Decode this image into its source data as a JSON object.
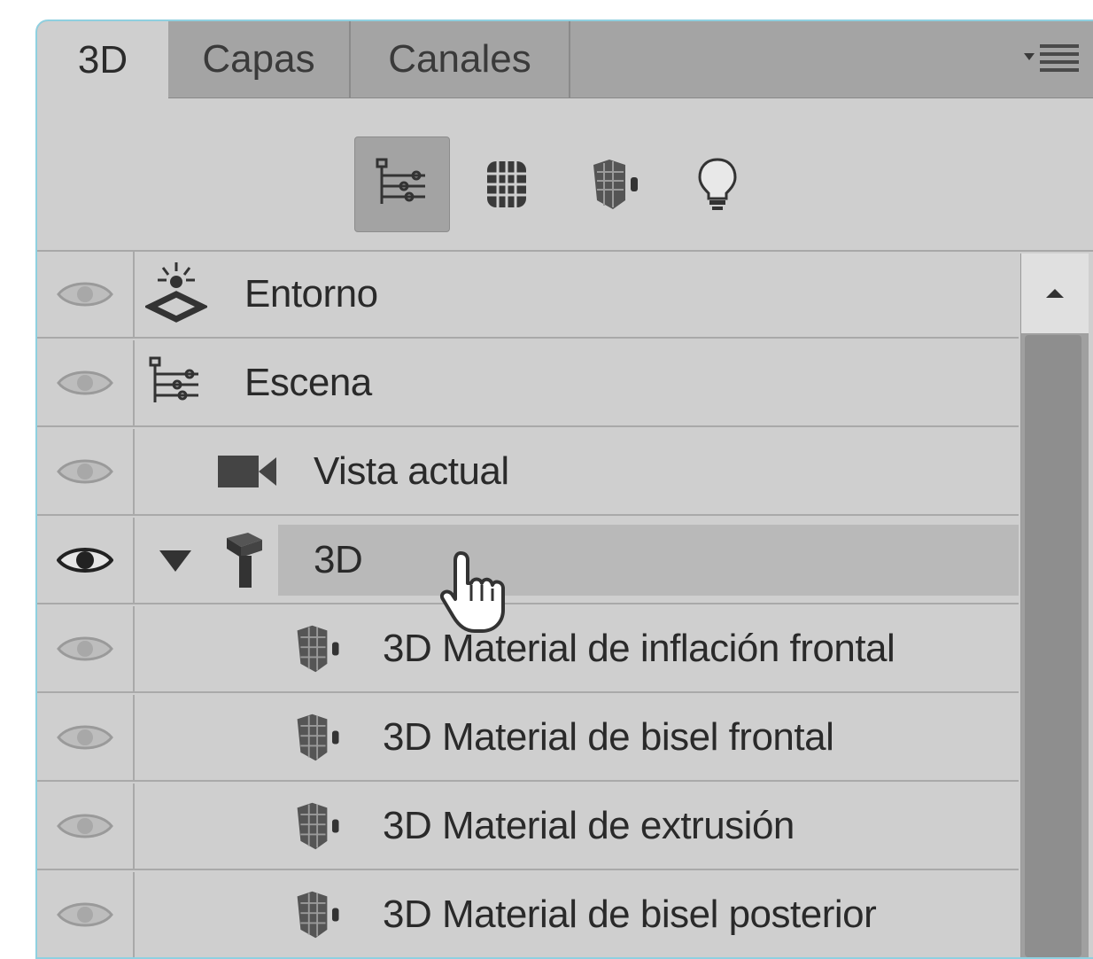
{
  "tabs": [
    {
      "label": "3D",
      "active": true
    },
    {
      "label": "Capas",
      "active": false
    },
    {
      "label": "Canales",
      "active": false
    }
  ],
  "panel_menu_icon": "panel-menu-icon",
  "toolbar": {
    "buttons": [
      {
        "name": "whole-scene",
        "icon": "scene-icon",
        "selected": true
      },
      {
        "name": "meshes",
        "icon": "mesh-icon",
        "selected": false
      },
      {
        "name": "materials",
        "icon": "material-icon",
        "selected": false
      },
      {
        "name": "lights",
        "icon": "light-icon",
        "selected": false
      }
    ]
  },
  "layers": [
    {
      "label": "Entorno",
      "icon": "environment-icon",
      "visible": true,
      "selected": false
    },
    {
      "label": "Escena",
      "icon": "scene-icon",
      "visible": true,
      "selected": false
    },
    {
      "label": "Vista actual",
      "icon": "camera-icon",
      "visible": true,
      "selected": false
    },
    {
      "label": "3D",
      "icon": "mesh-object-icon",
      "visible": true,
      "selected": true,
      "expanded": true
    },
    {
      "label": "3D Material de inflación frontal",
      "icon": "material-icon",
      "visible": true,
      "selected": false
    },
    {
      "label": "3D Material de bisel frontal",
      "icon": "material-icon",
      "visible": true,
      "selected": false
    },
    {
      "label": "3D Material de extrusión",
      "icon": "material-icon",
      "visible": true,
      "selected": false
    },
    {
      "label": "3D Material de bisel posterior",
      "icon": "material-icon",
      "visible": true,
      "selected": false
    }
  ],
  "colors": {
    "panel_bg": "#cfcfcf",
    "tabbar_bg": "#a4a4a4",
    "selected_row": "#b9b9b9",
    "frame_border": "#8fd0e0"
  }
}
